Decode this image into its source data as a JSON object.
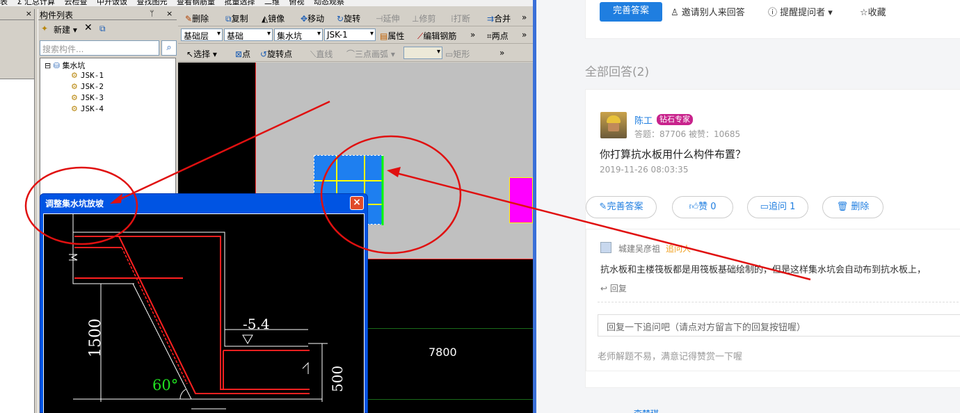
{
  "cad": {
    "topbar_items": [
      "表",
      "Σ 汇总计算",
      "云检查",
      "中开饭饭",
      "查找图元",
      "查看钢筋量",
      "批量选择",
      "二维",
      "俯视",
      "动态观察"
    ],
    "strip_close": "× ",
    "panel": {
      "title": "构件列表",
      "pin": "ᛘ",
      "close": "×",
      "new_label": "新建 ▾",
      "delete_icon": "✕",
      "copy_icon": "⧉",
      "search_placeholder": "搜索构件...",
      "tree": {
        "root": "集水坑",
        "items": [
          "JSK-1",
          "JSK-2",
          "JSK-3",
          "JSK-4"
        ],
        "selected": "JSK-1"
      }
    },
    "toolbar1": {
      "delete": "删除",
      "copy": "复制",
      "mirror": "镜像",
      "move": "移动",
      "rotate": "旋转",
      "extend": "延伸",
      "trim": "修剪",
      "break": "打断",
      "merge": "合并",
      "more": "»"
    },
    "toolbar2": {
      "layer": "基础层",
      "category": "基础",
      "type": "集水坑",
      "component": "JSK-1",
      "properties": "属性",
      "edit_rebar": "编辑钢筋",
      "more": "»",
      "two_point": "两点",
      "more2": "»"
    },
    "toolbar3": {
      "select": "选择",
      "point": "点",
      "rotate_point": "旋转点",
      "line": "直线",
      "arc": "三点画弧",
      "rect": "矩形",
      "more": "»"
    },
    "canvas": {
      "dimension": "7800"
    },
    "dialog": {
      "title": "调整集水坑放坡",
      "close": "×",
      "depth": "1500",
      "elevation": "-5.4",
      "thickness": "500",
      "angle": "60°"
    }
  },
  "web": {
    "top_actions": {
      "improve": "完善答案",
      "invite": "邀请别人来回答",
      "remind": "提醒提问者",
      "favorite": "收藏"
    },
    "all_answers": "全部回答(2)",
    "answer": {
      "user": "陈工",
      "badge": "钻石专家",
      "stats": "答题：87706   被赞：10685",
      "text": "你打算抗水板用什么构件布置？",
      "time": "2019-11-26 08:03:35",
      "actions": {
        "improve": "完善答案",
        "like": "赞 0",
        "followup": "追问 1",
        "delete": "删除"
      }
    },
    "followup": {
      "user": "城建吴彦祖",
      "role": "追问人",
      "text": "抗水板和主楼筏板都是用筏板基础绘制的，但是这样集水坑会自动布到抗水板上，",
      "reply": "回复",
      "input_placeholder": "回复一下追问吧（请点对方留言下的回复按钮喔）",
      "tip": "老师解题不易，满意记得赞赏一下喔"
    },
    "next_user": "李梦琪"
  },
  "colors": {
    "cad_chrome": "#d4d0c8",
    "xp_blue": "#0054e3",
    "web_blue": "#1f7ee0",
    "annotation_red": "#e01010",
    "badge_purple": "#c8238c"
  }
}
